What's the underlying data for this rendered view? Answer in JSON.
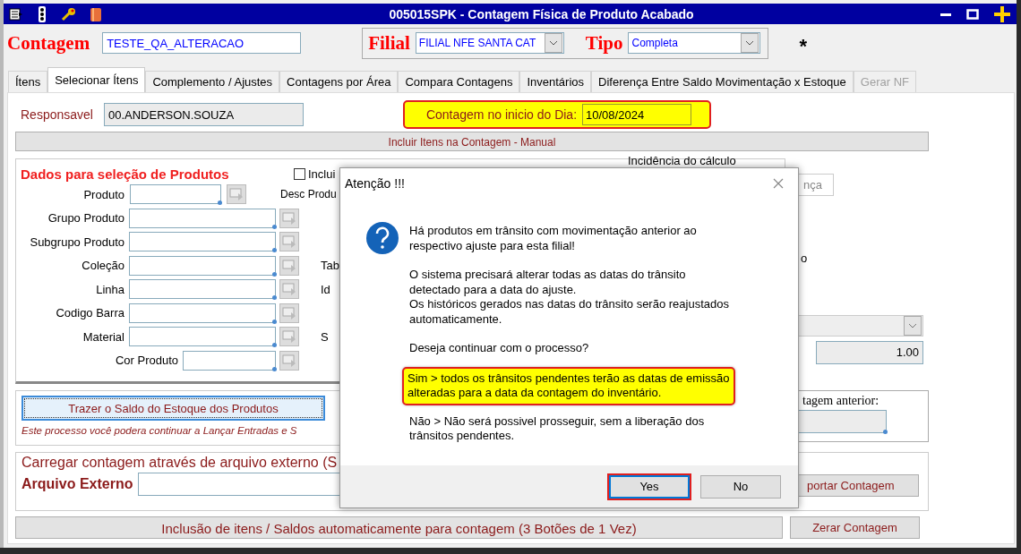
{
  "window": {
    "title": "005015SPK - Contagem Física de Produto Acabado"
  },
  "header": {
    "contagem_label": "Contagem",
    "contagem_value": "TESTE_QA_ALTERACAO",
    "filial_label": "Filial",
    "filial_value": "FILIAL NFE SANTA CAT",
    "tipo_label": "Tipo",
    "tipo_value": "Completa",
    "required_mark": "*"
  },
  "tabs": [
    {
      "label": "Ítens",
      "selected": false,
      "disabled": false
    },
    {
      "label": "Selecionar Ítens",
      "selected": true,
      "disabled": false
    },
    {
      "label": "Complemento / Ajustes",
      "selected": false,
      "disabled": false
    },
    {
      "label": "Contagens por Área",
      "selected": false,
      "disabled": false
    },
    {
      "label": "Compara Contagens",
      "selected": false,
      "disabled": false
    },
    {
      "label": "Inventários",
      "selected": false,
      "disabled": false
    },
    {
      "label": "Diferença Entre Saldo Movimentação x Estoque",
      "selected": false,
      "disabled": false
    },
    {
      "label": "Gerar NF",
      "selected": false,
      "disabled": true
    }
  ],
  "responsavel": {
    "label": "Responsavel",
    "value": "00.ANDERSON.SOUZA"
  },
  "inicio": {
    "label": "Contagem no inicio do Dia:",
    "value": "10/08/2024"
  },
  "manual_bar": "Incluir Itens na Contagem - Manual",
  "selecao": {
    "title": "Dados para seleção de Produtos",
    "checkbox": {
      "label": "Inclui",
      "checked": false
    },
    "incidencia": "Incidência do cálculo",
    "fields": [
      {
        "label": "Produto",
        "kind": "short",
        "side_label": "Desc Produ"
      },
      {
        "label": "Grupo Produto",
        "kind": "wide"
      },
      {
        "label": "Subgrupo Produto",
        "kind": "wide"
      },
      {
        "label": "Coleção",
        "kind": "wide",
        "side_label": "Tab"
      },
      {
        "label": "Linha",
        "kind": "wide",
        "side_label": "Id"
      },
      {
        "label": "Codigo Barra",
        "kind": "wide"
      },
      {
        "label": "Material",
        "kind": "wide",
        "side_label": "S"
      },
      {
        "label": "Cor Produto",
        "kind": "offset"
      }
    ]
  },
  "side": {
    "button": "nça",
    "text": "o",
    "fator": "1.00"
  },
  "trazer": {
    "button": "Trazer o Saldo do Estoque dos Produtos",
    "note": "Este processo você podera continuar a Lançar Entradas e S"
  },
  "anterior": {
    "label": "tagem anterior:"
  },
  "arquivo": {
    "title": "Carregar contagem através de arquivo externo (S",
    "label": "Arquivo Externo",
    "button": "portar Contagem"
  },
  "auto_bar": "Inclusão de itens / Saldos automaticamente para contagem (3 Botões de 1 Vez)",
  "zerar": "Zerar Contagem",
  "dialog": {
    "title": "Atenção !!!",
    "paragraphs": [
      {
        "lines": [
          "Há produtos em trânsito com movimentação anterior ao",
          "respectivo ajuste para esta filial!"
        ],
        "highlighted": false
      },
      {
        "lines": [
          "O sistema precisará alterar todas as datas do trânsito",
          "detectado para a data do ajuste.",
          "Os históricos gerados nas datas do trânsito serão reajustados",
          "automaticamente."
        ],
        "highlighted": false
      },
      {
        "lines": [
          "Deseja continuar com o processo?"
        ],
        "highlighted": false
      },
      {
        "lines": [
          "Sim > todos os trânsitos pendentes terão as datas de emissão",
          "alteradas para a data da contagem do inventário."
        ],
        "highlighted": true
      },
      {
        "lines": [
          "Não > Não será possivel prosseguir, sem a liberação dos",
          "trânsitos pendentes."
        ],
        "highlighted": false
      }
    ],
    "buttons": [
      {
        "label": "Yes",
        "selected": true
      },
      {
        "label": "No",
        "selected": false
      }
    ]
  }
}
